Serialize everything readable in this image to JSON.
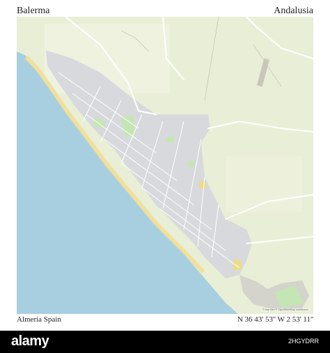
{
  "poster": {
    "title_left": "Balerma",
    "title_right": "Andalusia",
    "caption_left": "Almeria  Spain",
    "caption_right": "N 36 43' 53''   W 2 53' 11''"
  },
  "map": {
    "attribution": "© Map tiles © OpenStreetMap contributors",
    "colors": {
      "sea": "#a8cfe0",
      "land": "#e9efd6",
      "town": "#d7d9dc",
      "road": "#ffffff",
      "beach": "#f1df9c",
      "park": "#c4e6b4"
    }
  },
  "watermark": {
    "logo": "alamy",
    "image_id": "2HGYDRR"
  }
}
